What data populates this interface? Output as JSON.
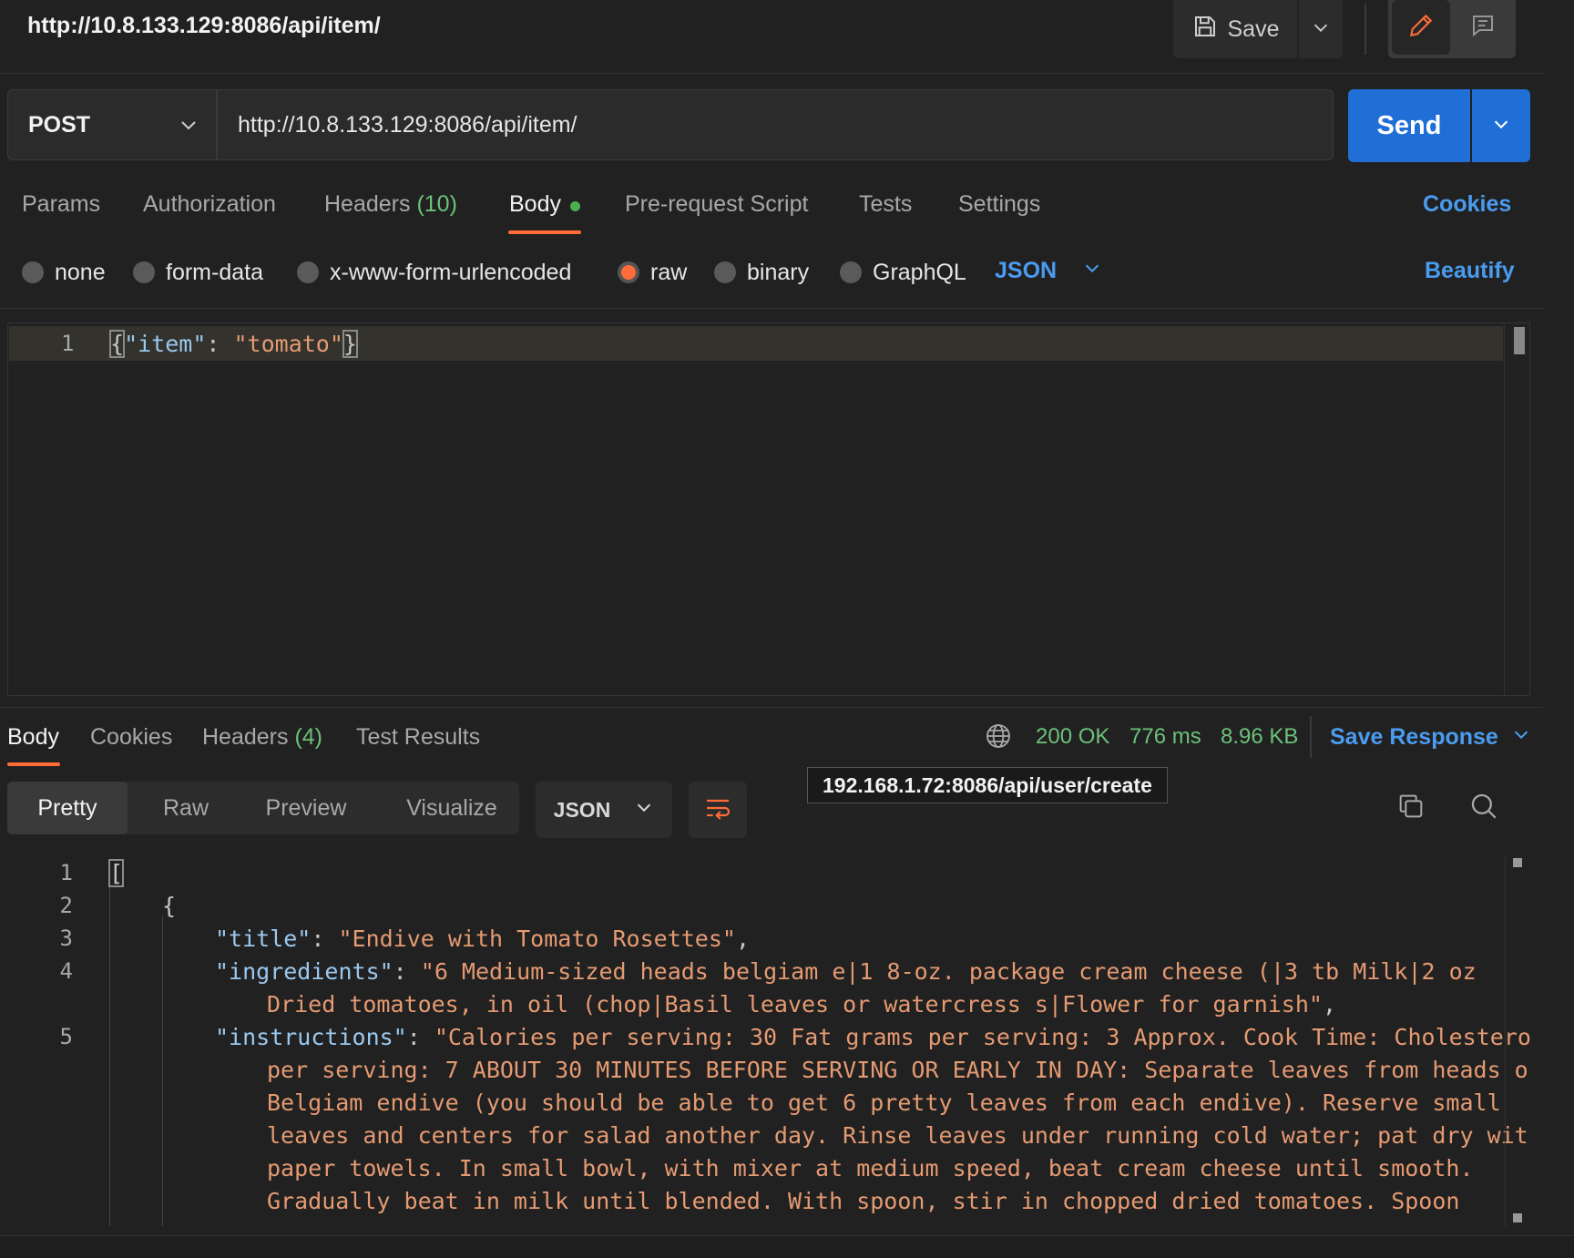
{
  "header": {
    "request_title": "http://10.8.133.129:8086/api/item/",
    "save_label": "Save"
  },
  "request": {
    "method": "POST",
    "url": "http://10.8.133.129:8086/api/item/",
    "send_label": "Send"
  },
  "request_tabs": {
    "params": "Params",
    "authorization": "Authorization",
    "headers": "Headers",
    "headers_count": "(10)",
    "body": "Body",
    "pre_request": "Pre-request Script",
    "tests": "Tests",
    "settings": "Settings",
    "cookies": "Cookies"
  },
  "body_types": {
    "none": "none",
    "form_data": "form-data",
    "urlencoded": "x-www-form-urlencoded",
    "raw": "raw",
    "binary": "binary",
    "graphql": "GraphQL",
    "selected": "raw",
    "language": "JSON",
    "beautify": "Beautify"
  },
  "request_body": {
    "line_number": "1",
    "open_brace": "{",
    "key": "\"item\"",
    "colon": ": ",
    "value": "\"tomato\"",
    "close_brace": "}"
  },
  "response_tabs": {
    "body": "Body",
    "cookies": "Cookies",
    "headers": "Headers",
    "headers_count": "(4)",
    "test_results": "Test Results"
  },
  "response_meta": {
    "status": "200 OK",
    "time": "776 ms",
    "size": "8.96 KB",
    "save_response": "Save Response",
    "tooltip": "192.168.1.72:8086/api/user/create"
  },
  "response_view": {
    "pretty": "Pretty",
    "raw": "Raw",
    "preview": "Preview",
    "visualize": "Visualize",
    "format": "JSON"
  },
  "response_body": {
    "line_numbers": [
      "1",
      "2",
      "3",
      "4",
      "5"
    ],
    "bracket": "[",
    "brace": "{",
    "title_key": "\"title\"",
    "title_value": "\"Endive with Tomato Rosettes\"",
    "ingredients_key": "\"ingredients\"",
    "ingredients_value_1": "\"6 Medium-sized heads belgiam e|1 8-oz. package cream cheese (|3 tb Milk|2 oz",
    "ingredients_value_2": "Dried tomatoes, in oil (chop|Basil leaves or watercress s|Flower for garnish\"",
    "instructions_key": "\"instructions\"",
    "instructions_value_1": "\"Calories per serving: 30 Fat grams per serving: 3 Approx. Cook Time: Cholesterol",
    "instructions_value_2": "per serving: 7 ABOUT 30 MINUTES BEFORE SERVING OR EARLY IN DAY: Separate leaves from heads of",
    "instructions_value_3": "Belgiam endive (you should be able to get 6 pretty leaves from each endive). Reserve small",
    "instructions_value_4": "leaves and centers for salad another day. Rinse leaves under running cold water; pat dry with",
    "instructions_value_5": "paper towels. In small bowl, with mixer at medium speed, beat cream cheese until smooth.",
    "instructions_value_6": "Gradually beat in milk until blended. With spoon, stir in chopped dried tomatoes. Spoon"
  },
  "colors": {
    "accent_orange": "#ff6c37",
    "send_blue": "#1f6fd6",
    "link_blue": "#4a9cf0",
    "status_green": "#6cc17a",
    "json_key": "#9bc8ee",
    "json_string": "#e59a72"
  },
  "icons": [
    "save-icon",
    "chevron-down-icon",
    "pencil-icon",
    "comment-icon",
    "globe-icon",
    "wrap-lines-icon",
    "copy-icon",
    "search-icon"
  ]
}
